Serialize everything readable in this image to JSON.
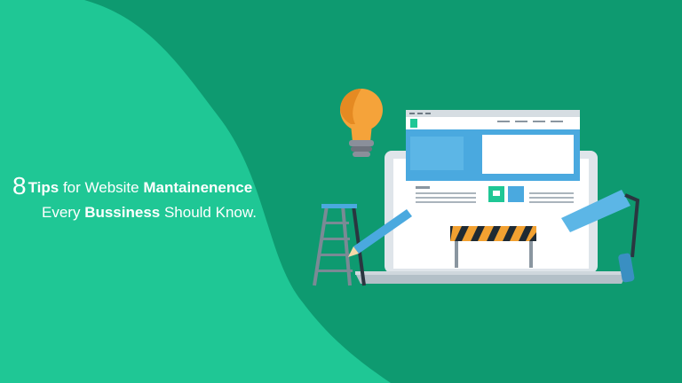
{
  "headline": {
    "number": "8",
    "line1_bold": "Tips",
    "line1_mid": " for Website ",
    "line1_bold2": "Mantainenence",
    "line2_start": "Every ",
    "line2_bold": "Bussiness",
    "line2_end": " Should Know."
  },
  "colors": {
    "background": "#0e9a70",
    "shape": "#1fc795",
    "blue": "#4aa9df",
    "bulb": "#f5a33a",
    "stripe": "#f2a131"
  },
  "illustration": {
    "icons": [
      "light-bulb-icon",
      "laptop-icon",
      "ladder-icon",
      "pencil-icon",
      "paint-roller-icon",
      "barrier-icon"
    ]
  }
}
